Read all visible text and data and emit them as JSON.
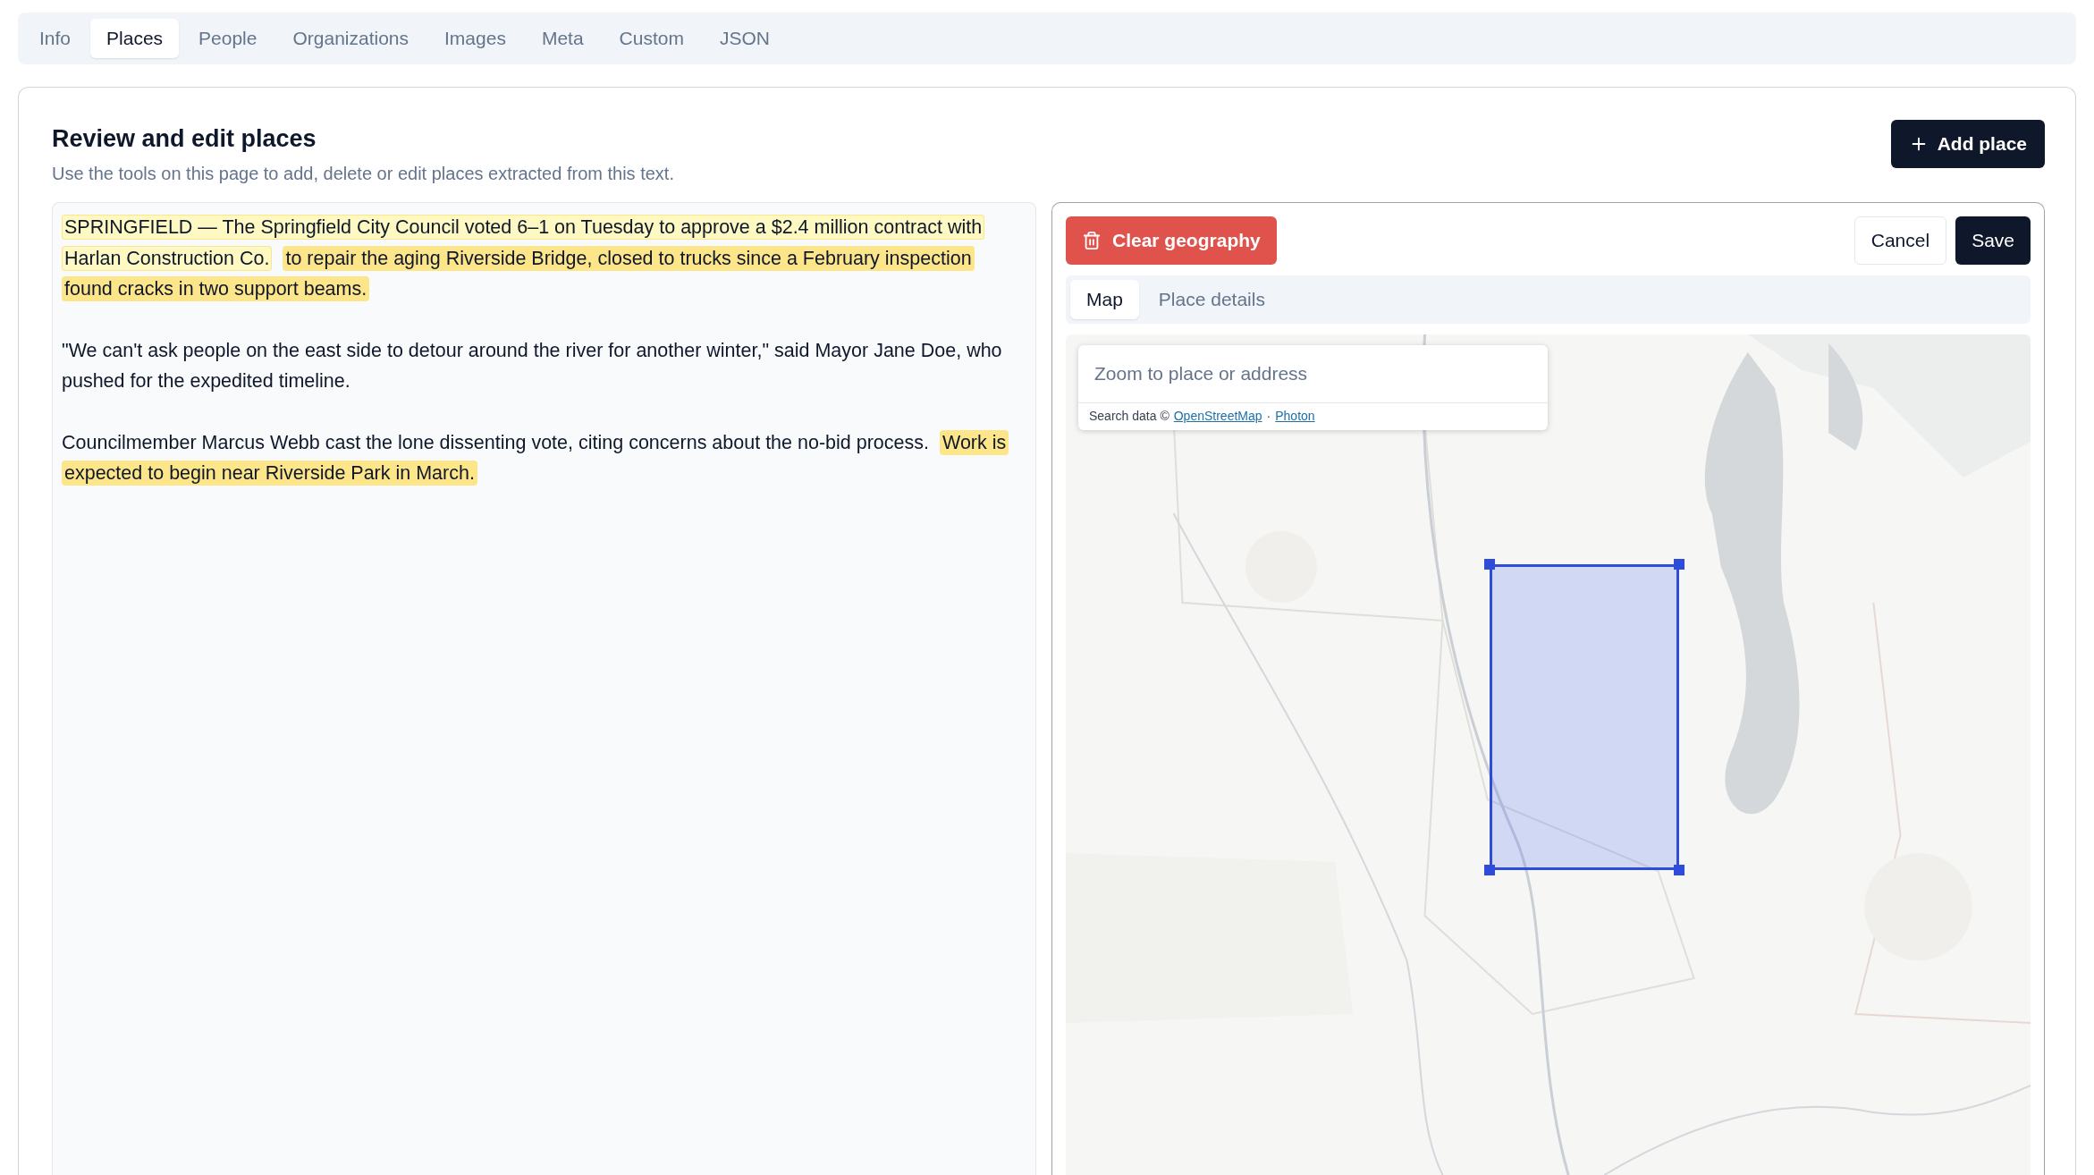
{
  "tabs": [
    {
      "label": "Info",
      "selected": false
    },
    {
      "label": "Places",
      "selected": true
    },
    {
      "label": "People",
      "selected": false
    },
    {
      "label": "Organizations",
      "selected": false
    },
    {
      "label": "Images",
      "selected": false
    },
    {
      "label": "Meta",
      "selected": false
    },
    {
      "label": "Custom",
      "selected": false
    },
    {
      "label": "JSON",
      "selected": false
    }
  ],
  "header": {
    "title": "Review and edit places",
    "subtitle": "Use the tools on this page to add, delete or edit places extracted from this text.",
    "add_button": "Add place"
  },
  "article": [
    [
      [
        {
          "kind": "highlight",
          "selected": true,
          "text": "SPRINGFIELD — The Springfield City Council voted 6–1 on Tuesday to approve a $2.4 million contract with"
        }
      ],
      [
        {
          "kind": "highlight",
          "selected": true,
          "text": "Harlan Construction Co."
        },
        {
          "kind": "highlight",
          "selected": false,
          "text": "to repair the aging Riverside Bridge, closed to trucks since a February inspection"
        }
      ],
      [
        {
          "kind": "highlight",
          "selected": false,
          "text": "found cracks in two support beams."
        }
      ]
    ],
    [
      [
        {
          "kind": "plain",
          "text": "\"We can't ask people on the east side to detour around the river for another winter,\" said Mayor Jane Doe, who"
        }
      ],
      [
        {
          "kind": "plain",
          "text": "pushed for the expedited timeline."
        }
      ]
    ],
    [
      [
        {
          "kind": "plain",
          "text": "Councilmember Marcus Webb cast the lone dissenting vote, citing concerns about the no-bid process."
        },
        {
          "kind": "highlight",
          "selected": false,
          "text": "Work is"
        }
      ],
      [
        {
          "kind": "highlight",
          "selected": false,
          "text": "expected to begin near Riverside Park in March."
        }
      ]
    ]
  ],
  "editor": {
    "clear_button": "Clear geography",
    "cancel_button": "Cancel",
    "save_button": "Save",
    "tabs": [
      {
        "label": "Map",
        "selected": true
      },
      {
        "label": "Place details",
        "selected": false
      }
    ],
    "map": {
      "kind": "picture",
      "search": {
        "placeholder": "Zoom to place or address",
        "attribution": "Search data ©",
        "links": [
          "OpenStreetMap",
          "Photon"
        ],
        "separator": "·"
      },
      "selection": {
        "kind": "rectangle"
      }
    }
  }
}
